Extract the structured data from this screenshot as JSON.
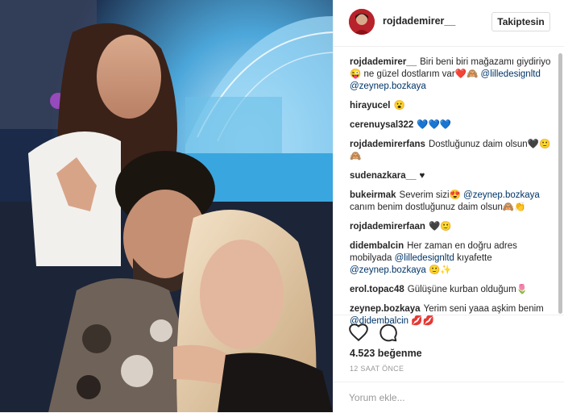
{
  "post": {
    "image_alt": "Selfie of three people at night by a lit pool",
    "username": "rojdademirer__",
    "follow_label": "Takiptesin",
    "likes": "4.523 beğenme",
    "timestamp": "12 SAAT ÖNCE",
    "comment_placeholder": "Yorum ekle..."
  },
  "comments": [
    {
      "user": "rojdademirer__",
      "parts": [
        {
          "type": "text",
          "value": "Biri beni biri mağazamı giydiriyo"
        },
        {
          "type": "text",
          "value": "😜"
        },
        {
          "type": "text",
          "value": " ne güzel dostlarım var"
        },
        {
          "type": "text",
          "value": "❤️🙈"
        },
        {
          "type": "text",
          "value": " "
        },
        {
          "type": "mention",
          "value": "@lilledesignltd"
        },
        {
          "type": "text",
          "value": " "
        },
        {
          "type": "mention",
          "value": "@zeynep.bozkaya"
        }
      ]
    },
    {
      "user": "hirayucel",
      "parts": [
        {
          "type": "text",
          "value": "😮"
        }
      ]
    },
    {
      "user": "cerenuysal322",
      "parts": [
        {
          "type": "text",
          "value": "💙💙💙"
        }
      ]
    },
    {
      "user": "rojdademirerfans",
      "parts": [
        {
          "type": "text",
          "value": "Dostluğunuz daim olsun"
        },
        {
          "type": "text",
          "value": "🖤🙂🙈"
        }
      ]
    },
    {
      "user": "sudenazkara__",
      "parts": [
        {
          "type": "text",
          "value": "♥"
        }
      ]
    },
    {
      "user": "bukeirmak",
      "parts": [
        {
          "type": "text",
          "value": "Severim sizi"
        },
        {
          "type": "text",
          "value": "😍"
        },
        {
          "type": "text",
          "value": " "
        },
        {
          "type": "mention",
          "value": "@zeynep.bozkaya"
        },
        {
          "type": "text",
          "value": " canım benim dostluğunuz daim olsun"
        },
        {
          "type": "text",
          "value": "🙈👏"
        }
      ]
    },
    {
      "user": "rojdademirerfaan",
      "parts": [
        {
          "type": "text",
          "value": "🖤🙂"
        }
      ]
    },
    {
      "user": "didembalcin",
      "parts": [
        {
          "type": "text",
          "value": "Her zaman en doğru adres mobilyada "
        },
        {
          "type": "mention",
          "value": "@lilledesignltd"
        },
        {
          "type": "text",
          "value": " kıyafette "
        },
        {
          "type": "mention",
          "value": "@zeynep.bozkaya"
        },
        {
          "type": "text",
          "value": " 🙂✨"
        }
      ]
    },
    {
      "user": "erol.topac48",
      "parts": [
        {
          "type": "text",
          "value": "Gülüşüne kurban olduğum"
        },
        {
          "type": "text",
          "value": "🌷"
        }
      ]
    },
    {
      "user": "zeynep.bozkaya",
      "parts": [
        {
          "type": "text",
          "value": "Yerim seni yaaa aşkim benim "
        },
        {
          "type": "mention",
          "value": "@didembalcin"
        },
        {
          "type": "text",
          "value": " 💋💋"
        }
      ]
    }
  ],
  "icons": {
    "like": "heart-icon",
    "comment": "comment-icon"
  },
  "colors": {
    "mention": "#003569",
    "text": "#262626",
    "muted": "#999999",
    "border": "#efefef"
  }
}
